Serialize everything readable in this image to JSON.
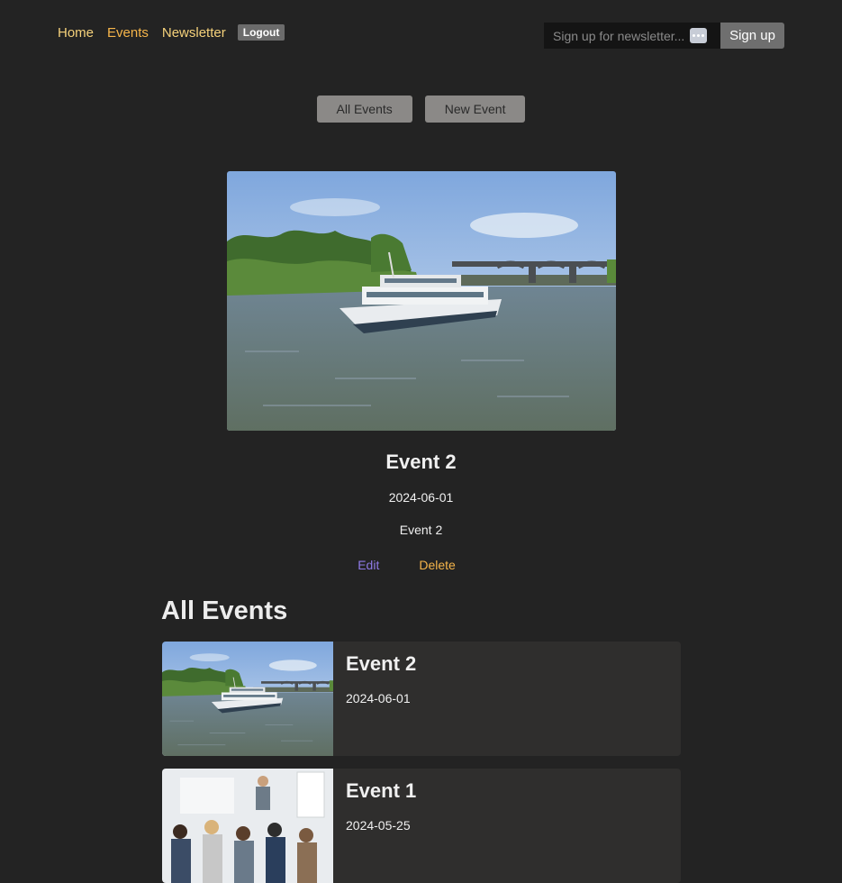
{
  "nav": {
    "items": [
      {
        "label": "Home",
        "active": false
      },
      {
        "label": "Events",
        "active": true
      },
      {
        "label": "Newsletter",
        "active": false
      }
    ],
    "logout_label": "Logout"
  },
  "newsletter": {
    "placeholder": "Sign up for newsletter...",
    "button_label": "Sign up"
  },
  "actions": {
    "all_events_label": "All Events",
    "new_event_label": "New Event"
  },
  "featured_event": {
    "image": "river-boat-photo",
    "title": "Event 2",
    "date": "2024-06-01",
    "description": "Event 2",
    "edit_label": "Edit",
    "delete_label": "Delete"
  },
  "events_list": {
    "heading": "All Events",
    "items": [
      {
        "title": "Event 2",
        "date": "2024-06-01",
        "image": "river-boat-photo"
      },
      {
        "title": "Event 1",
        "date": "2024-05-25",
        "image": "conference-audience-photo"
      }
    ]
  },
  "colors": {
    "background": "#232323",
    "nav_link": "#f5d17a",
    "nav_active": "#f6b54a",
    "edit_link": "#8f7ae6",
    "delete_link": "#f6b54a",
    "card_background": "#2f2e2d"
  }
}
